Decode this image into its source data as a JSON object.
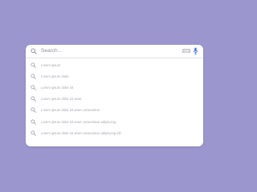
{
  "search": {
    "placeholder": "Search..."
  },
  "toolbar": {
    "keyboard_icon": "keyboard-icon",
    "mic_icon": "microphone-icon",
    "mic_color": "#3a76f0"
  },
  "suggestions": [
    {
      "label": "Lorem ipsum",
      "icon": "search-icon"
    },
    {
      "label": "Lorem ipsum dolor",
      "icon": "search-icon"
    },
    {
      "label": "Lorem ipsum dolor sit",
      "icon": "search-icon"
    },
    {
      "label": "Lorem ipsum dolor sit amet",
      "icon": "search-icon"
    },
    {
      "label": "Lorem ipsum dolor sit amet consectetur",
      "icon": "search-icon"
    },
    {
      "label": "Lorem ipsum dolor sit amet consectetur adipiscing",
      "icon": "search-icon"
    },
    {
      "label": "Lorem ipsum dolor sit amet consectetur adipiscing elit",
      "icon": "search-icon"
    }
  ],
  "colors": {
    "background": "#9b96cd",
    "card": "#ffffff",
    "icon": "#9a9ba5",
    "text": "#a8a9b1"
  }
}
